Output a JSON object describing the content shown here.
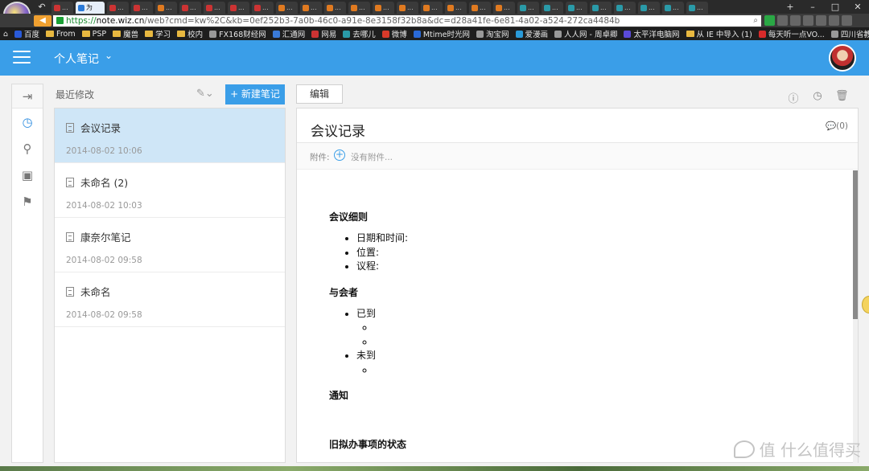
{
  "browser": {
    "active_tab_label": "为",
    "tab_label": "...",
    "url_https": "https://",
    "url_host": "note.wiz.cn",
    "url_rest": "/web?cmd=kw%2C&kb=0ef252b3-7a0b-46c0-a91e-8e3158f32b8a&dc=d28a41fe-6e81-4a02-a524-272ca4484b",
    "bookmarks": [
      "百度",
      "From",
      "PSP",
      "魔兽",
      "学习",
      "校内",
      "FX168财经网",
      "汇通网",
      "网易",
      "去哪儿",
      "微博",
      "Mtime时光网",
      "淘宝网",
      "爱漫画",
      "人人网 - 周卓卿",
      "太平洋电脑网",
      "从 IE 中导入 (1)",
      "每天听一点VO...",
      "四川省教育考..."
    ]
  },
  "header": {
    "title": "个人笔记"
  },
  "list": {
    "heading": "最近修改",
    "new_note_label": "+ 新建笔记",
    "notes": [
      {
        "title": "会议记录",
        "date": "2014-08-02 10:06"
      },
      {
        "title": "未命名 (2)",
        "date": "2014-08-02 10:03"
      },
      {
        "title": "康奈尔笔记",
        "date": "2014-08-02 09:58"
      },
      {
        "title": "未命名",
        "date": "2014-08-02 09:58"
      }
    ]
  },
  "editor": {
    "edit_label": "编辑",
    "title": "会议记录",
    "comment_count": "(0)",
    "attachments_label": "附件:",
    "no_attachments": "没有附件...",
    "content": {
      "s1_heading": "会议细则",
      "s1_items": [
        "日期和时间:",
        "位置:",
        "议程:"
      ],
      "s2_heading": "与会者",
      "s2_present": "已到",
      "s2_absent": "未到",
      "s3_heading": "通知",
      "s4_heading": "旧拟办事项的状态"
    }
  },
  "watermark": "值 什么值得买"
}
